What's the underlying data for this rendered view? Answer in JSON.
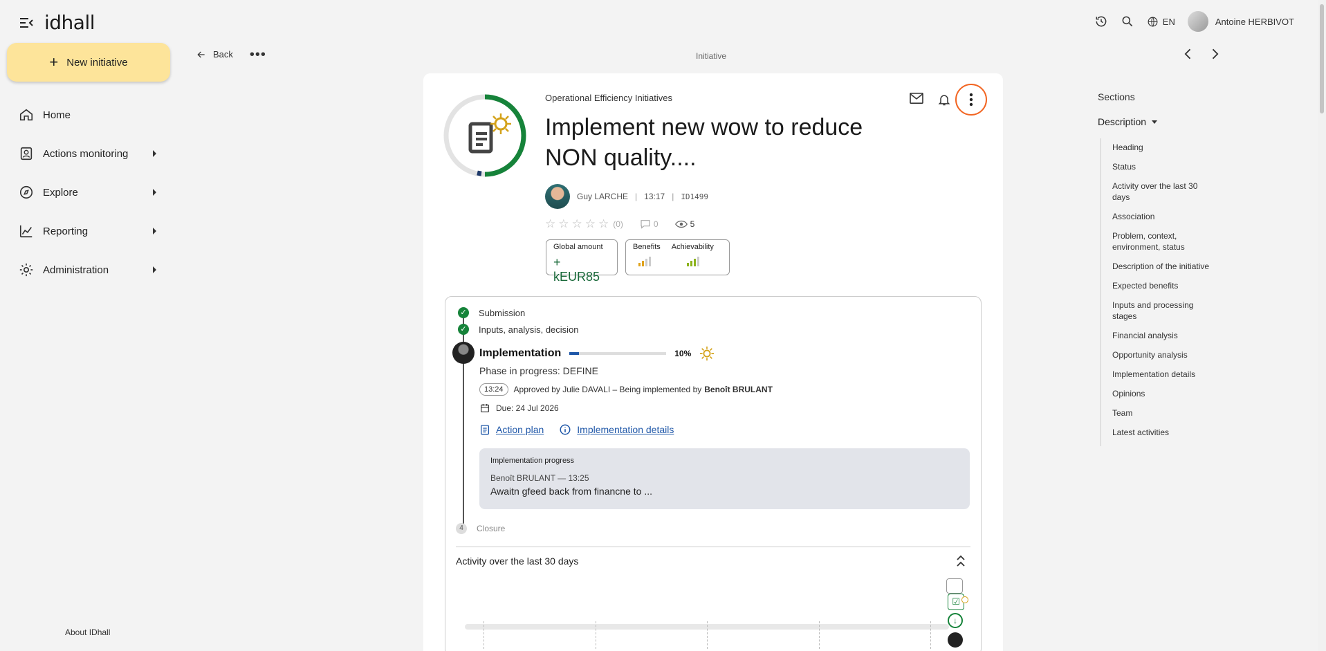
{
  "app": {
    "logo": "idhall",
    "about": "About IDhall"
  },
  "new_initiative": "New initiative",
  "nav": [
    {
      "label": "Home",
      "icon": "home-icon"
    },
    {
      "label": "Actions monitoring",
      "icon": "clipboard-user-icon"
    },
    {
      "label": "Explore",
      "icon": "compass-icon"
    },
    {
      "label": "Reporting",
      "icon": "chart-icon"
    },
    {
      "label": "Administration",
      "icon": "gear-icon"
    }
  ],
  "topbar": {
    "language": "EN",
    "user": "Antoine HERBIVOT"
  },
  "back_label": "Back",
  "breadcrumb": "Initiative",
  "initiative": {
    "category": "Operational Efficiency Initiatives",
    "title": "Implement new wow to reduce NON quality....",
    "author": "Guy LARCHE",
    "time": "13:17",
    "id": "ID1499",
    "rating_count": "(0)",
    "comments": "0",
    "views": "5",
    "global_amount_label": "Global amount",
    "global_amount_value": "+ kEUR85",
    "benefits_label": "Benefits",
    "achievability_label": "Achievability",
    "benefits_level": 2,
    "achievability_level": 3
  },
  "workflow": {
    "step1": "Submission",
    "step2": "Inputs, analysis, decision",
    "step3": "Implementation",
    "progress_pct": 10,
    "progress_label": "10%",
    "phase": "Phase in progress: DEFINE",
    "approved_time": "13:24",
    "approved_text": "Approved by Julie DAVALI – Being implemented by",
    "implementer": "Benoît BRULANT",
    "due": "Due: 24 Jul 2026",
    "action_plan": "Action plan",
    "impl_details": "Implementation details",
    "note_header": "Implementation progress",
    "note_meta": "Benoît BRULANT — 13:25",
    "note_body": "Awaitn gfeed back from financne to ...",
    "step4_num": "4",
    "step4": "Closure"
  },
  "activity_title": "Activity over the last 30 days",
  "sections": {
    "title": "Sections",
    "group": "Description",
    "items": [
      "Heading",
      "Status",
      "Activity over the last 30 days",
      "Association",
      "Problem, context, environment, status",
      "Description of the initiative",
      "Expected benefits",
      "Inputs and processing stages",
      "Financial analysis",
      "Opportunity analysis",
      "Implementation details",
      "Opinions",
      "Team",
      "Latest activities"
    ]
  },
  "colors": {
    "accent_yellow": "#fde49a",
    "green": "#16833a",
    "blue_link": "#1f57a8",
    "highlight_ring": "#f26522"
  }
}
